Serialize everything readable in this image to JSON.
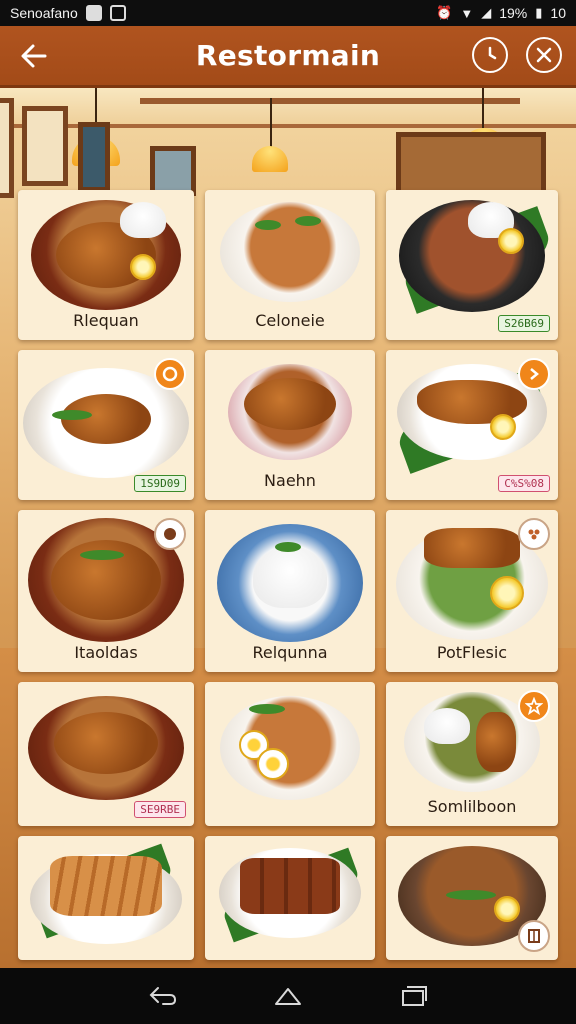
{
  "status_bar": {
    "carrier": "Senoafano",
    "battery": "19%",
    "time": "10"
  },
  "header": {
    "title": "Restormain"
  },
  "icons": {
    "back": "arrow-left-icon",
    "clock": "clock-icon",
    "close": "close-icon",
    "nav_back": "nav-back-icon",
    "nav_home": "nav-home-icon",
    "nav_recents": "nav-recents-icon"
  },
  "colors": {
    "header": "#a34b18",
    "card": "#fbeed5",
    "badge_orange": "#f0861a"
  },
  "menu": {
    "items": [
      {
        "label": "Rlequan",
        "price": ""
      },
      {
        "label": "Celoneie",
        "price": ""
      },
      {
        "label": "",
        "price": "S26B69"
      },
      {
        "label": "",
        "price": "1S9D09"
      },
      {
        "label": "Naehn",
        "price": ""
      },
      {
        "label": "",
        "price": "C%S%08"
      },
      {
        "label": "Itaoldas",
        "price": ""
      },
      {
        "label": "Relqunna",
        "price": ""
      },
      {
        "label": "PotFlesic",
        "price": ""
      },
      {
        "label": "",
        "price": "SE9RBE"
      },
      {
        "label": "",
        "price": ""
      },
      {
        "label": "Somlilboon",
        "price": ""
      },
      {
        "label": "",
        "price": ""
      },
      {
        "label": "",
        "price": ""
      },
      {
        "label": "",
        "price": ""
      }
    ]
  }
}
